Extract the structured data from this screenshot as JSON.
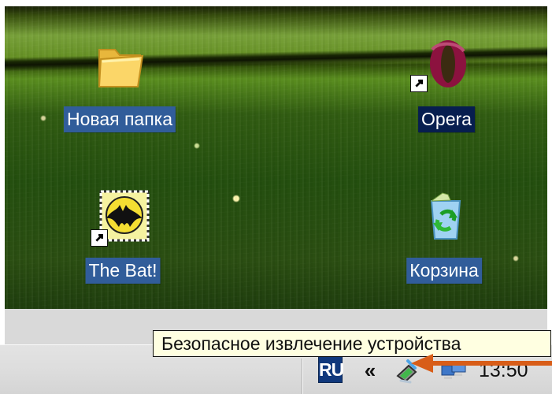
{
  "desktop": {
    "icons": [
      {
        "label": "Новая папка",
        "icon": "folder-icon",
        "shortcut": false
      },
      {
        "label": "Opera",
        "icon": "opera-icon",
        "shortcut": true
      },
      {
        "label": "The Bat!",
        "icon": "the-bat-icon",
        "shortcut": true
      },
      {
        "label": "Корзина",
        "icon": "recycle-bin-icon",
        "shortcut": false
      }
    ]
  },
  "tooltip": {
    "text": "Безопасное извлечение устройства"
  },
  "taskbar": {
    "language": "RU",
    "show_hidden_icons": "«",
    "clock": "13:50",
    "tray_icons": [
      "safely-remove-hardware-icon",
      "network-icon"
    ]
  },
  "colors": {
    "selection": "#315d9a",
    "dark_selection": "#071e4f",
    "taskbar": "#dddddd",
    "tooltip": "#ffffe1",
    "pointer": "#d85d18"
  }
}
